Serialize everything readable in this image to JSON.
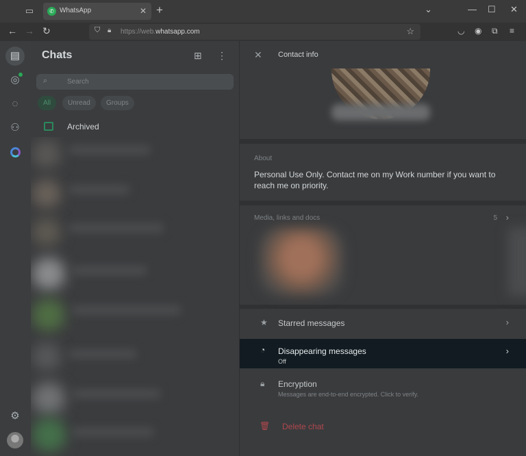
{
  "browser": {
    "tab_title": "WhatsApp",
    "url_prefix": "https://web.",
    "url_domain": "whatsapp.com"
  },
  "sidebar": {
    "title": "Chats",
    "search_placeholder": "Search",
    "filters": [
      "All",
      "Unread",
      "Groups"
    ],
    "archived_label": "Archived"
  },
  "contact_info": {
    "header_title": "Contact info",
    "about_label": "About",
    "about_text": "Personal Use Only. Contact me on my Work number if you want to reach me on priority.",
    "media_label": "Media, links and docs",
    "media_count": "5",
    "starred_label": "Starred messages",
    "disappearing_label": "Disappearing messages",
    "disappearing_value": "Off",
    "encryption_label": "Encryption",
    "encryption_sub": "Messages are end-to-end encrypted. Click to verify.",
    "delete_label": "Delete chat"
  },
  "colors": {
    "accent": "#2aa857",
    "highlight_row": "#111b21",
    "danger": "#b0484e"
  }
}
